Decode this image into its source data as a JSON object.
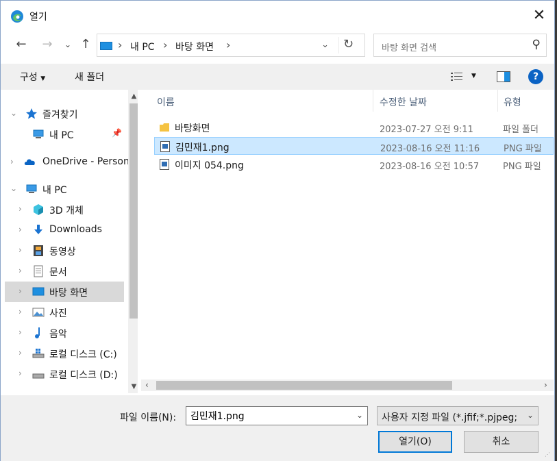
{
  "window": {
    "title": "열기"
  },
  "nav": {
    "breadcrumb": [
      "내 PC",
      "바탕 화면"
    ],
    "search_placeholder": "바탕 화면 검색"
  },
  "toolbar": {
    "organize_label": "구성",
    "new_folder_label": "새 폴더"
  },
  "sidebar": {
    "items": [
      {
        "label": "즐겨찾기",
        "icon": "star-icon"
      },
      {
        "label": "내 PC",
        "icon": "computer-icon"
      },
      {
        "label": "OneDrive - Personal",
        "icon": "cloud-icon"
      },
      {
        "label": "내 PC",
        "icon": "computer-icon"
      },
      {
        "label": "3D 개체",
        "icon": "cube-icon"
      },
      {
        "label": "Downloads",
        "icon": "download-icon"
      },
      {
        "label": "동영상",
        "icon": "film-icon"
      },
      {
        "label": "문서",
        "icon": "document-icon"
      },
      {
        "label": "바탕 화면",
        "icon": "desktop-icon"
      },
      {
        "label": "사진",
        "icon": "picture-icon"
      },
      {
        "label": "음악",
        "icon": "music-icon"
      },
      {
        "label": "로컬 디스크 (C:)",
        "icon": "drive-icon"
      },
      {
        "label": "로컬 디스크 (D:)",
        "icon": "drive-icon"
      }
    ]
  },
  "files": {
    "columns": [
      "이름",
      "수정한 날짜",
      "유형"
    ],
    "rows": [
      {
        "name": "바탕화면",
        "date": "2023-07-27 오전 9:11",
        "type": "파일 폴더",
        "icon": "folder-icon"
      },
      {
        "name": "김민재1.png",
        "date": "2023-08-16 오전 11:16",
        "type": "PNG 파일",
        "icon": "image-file-icon"
      },
      {
        "name": "이미지 054.png",
        "date": "2023-08-16 오전 10:57",
        "type": "PNG 파일",
        "icon": "image-file-icon"
      }
    ]
  },
  "bottom": {
    "filename_label": "파일 이름(N):",
    "filename_value": "김민재1.png",
    "filter_value": "사용자 지정 파일 (*.jfif;*.pjpeg;",
    "open_label": "열기(O)",
    "cancel_label": "취소"
  },
  "colors": {
    "accent": "#0078d7",
    "selection": "#cce8ff",
    "help": "#0b63c4"
  }
}
